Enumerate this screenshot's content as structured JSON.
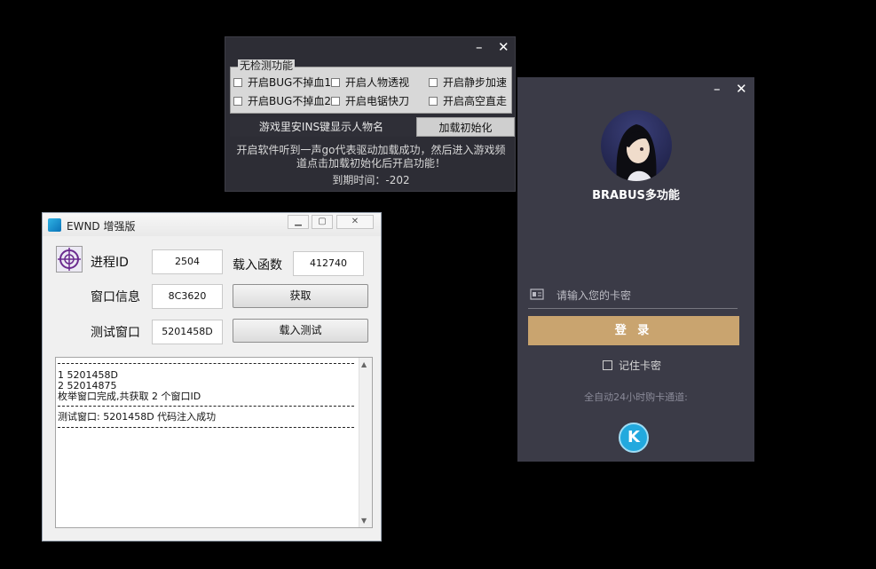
{
  "window_features": {
    "minimize_glyph": "–",
    "close_glyph": "✕",
    "group_title": "无检测功能",
    "checkboxes": [
      {
        "label": "开启BUG不掉血1",
        "checked": false
      },
      {
        "label": "开启人物透视",
        "checked": false
      },
      {
        "label": "开启静步加速",
        "checked": false
      },
      {
        "label": "开启BUG不掉血2",
        "checked": false
      },
      {
        "label": "开启电锯快刀",
        "checked": false
      },
      {
        "label": "开启高空直走",
        "checked": false
      }
    ],
    "ins_hint": "游戏里安INS键显示人物名",
    "init_button": "加载初始化",
    "notice_line1": "开启软件听到一声go代表驱动加载成功，然后进入游戏频",
    "notice_line2": "道点击加载初始化后开启功能！",
    "expiry": "到期时间：-202"
  },
  "window_ewnd": {
    "title": "EWND 增强版",
    "pid_label": "进程ID",
    "pid_value": "2504",
    "load_func_label": "载入函数",
    "load_func_value": "412740",
    "window_info_label": "窗口信息",
    "window_info_value": "8C3620",
    "get_button": "获取",
    "test_window_label": "测试窗口",
    "test_window_value": "5201458D",
    "load_test_button": "载入测试",
    "log_lines": [
      "1 5201458D",
      "2 52014875",
      "枚举窗口完成,共获取 2 个窗口ID",
      "测试窗口: 5201458D 代码注入成功"
    ]
  },
  "window_login": {
    "minimize_glyph": "–",
    "close_glyph": "✕",
    "brand": "BRABUS多功能",
    "card_placeholder": "请输入您的卡密",
    "login_button": "登 录",
    "remember_label": "记住卡密",
    "remember_checked": false,
    "channel_text": "全自动24小时购卡通道:",
    "logo_letter": "K"
  },
  "colors": {
    "accent_gold": "#c9a46f",
    "login_bg": "#3b3b47",
    "feature_bg": "#2d2d35",
    "k_logo": "#22a9de"
  }
}
